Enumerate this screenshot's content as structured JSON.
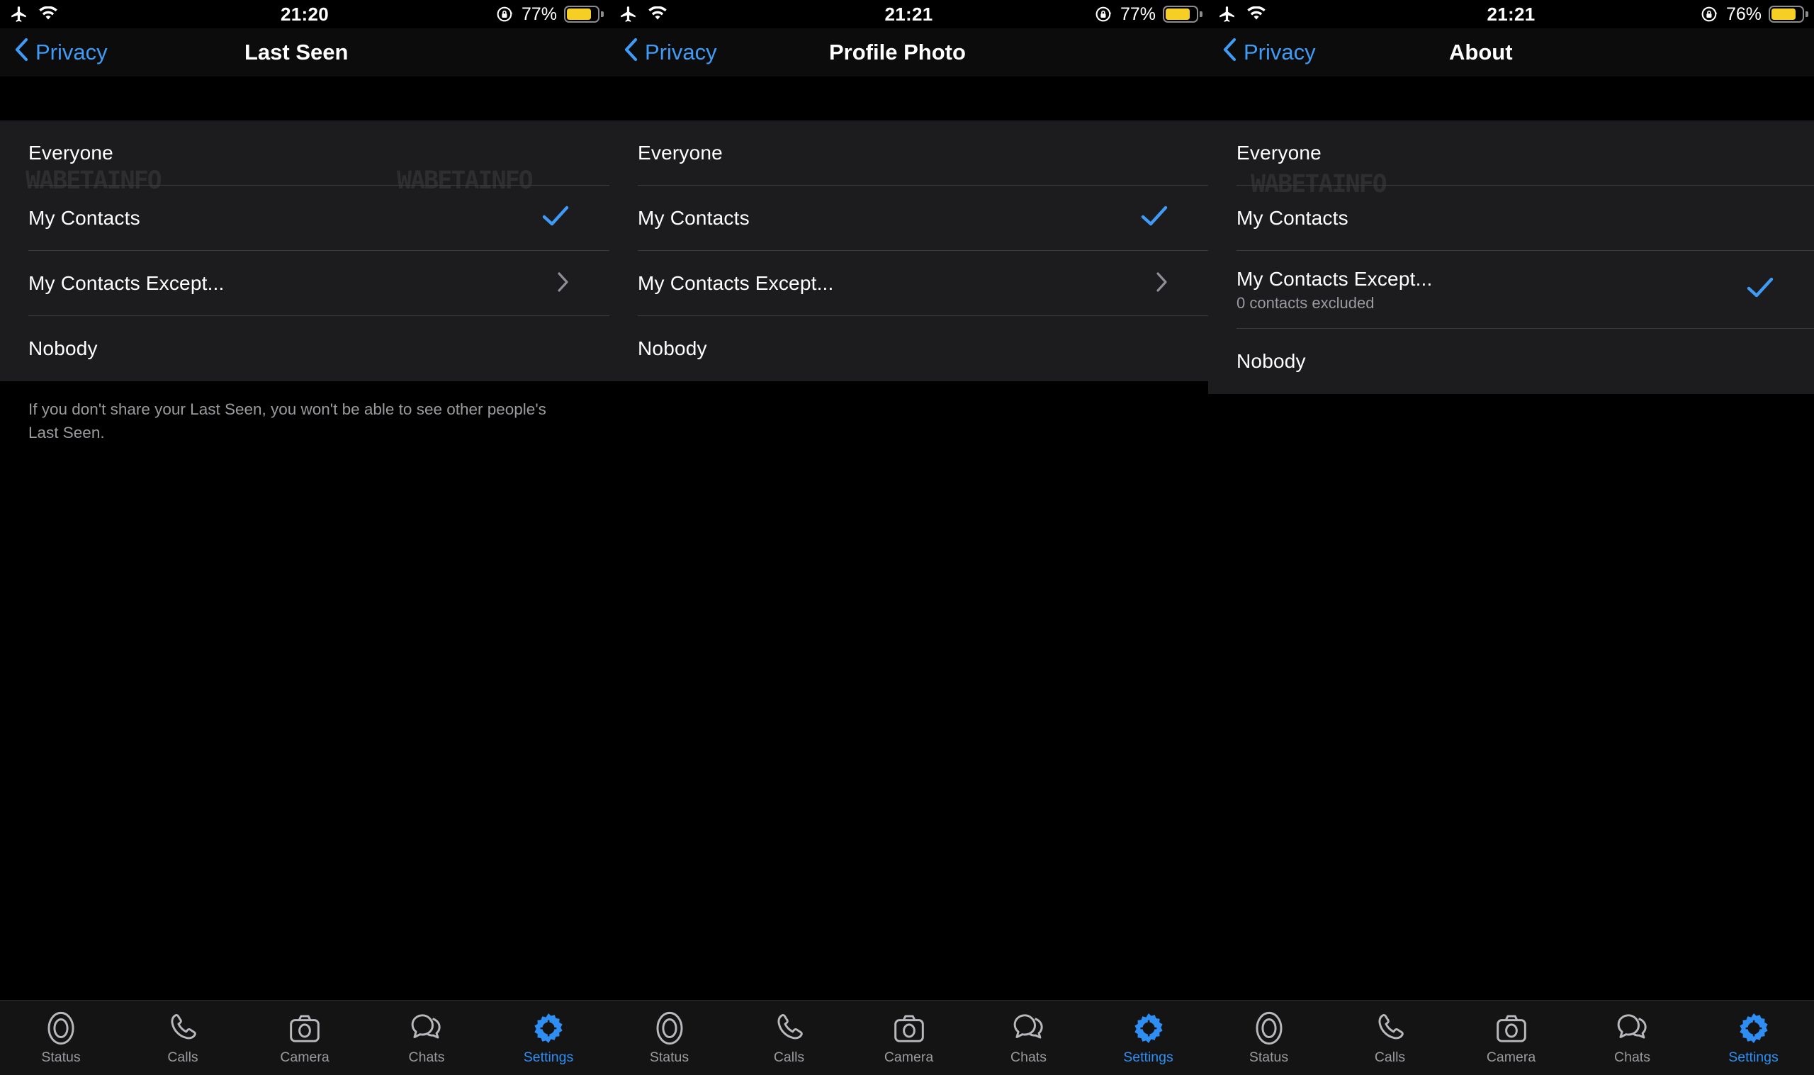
{
  "theme": {
    "background": "#000000",
    "list_background": "#1c1c1e",
    "navbar_background": "#0c0c0c",
    "accent_blue": "#3f9bf5",
    "separator": "#3a3a3c",
    "secondary_text": "#9b9b9f",
    "battery_yellow": "#f5cf24"
  },
  "watermark": {
    "text": "WABETAINFO"
  },
  "panels": [
    {
      "id": "last-seen",
      "status": {
        "time": "21:20",
        "battery_percent": "77%",
        "icons": {
          "airplane": "airplane-mode-icon",
          "wifi": "wifi-icon",
          "rotation_lock": "rotation-lock-icon",
          "battery": "battery-icon"
        }
      },
      "nav": {
        "back_label": "Privacy",
        "title": "Last Seen",
        "back_icon": "chevron-left-icon"
      },
      "rows": [
        {
          "title": "Everyone",
          "subtitle": "",
          "accessory": "none"
        },
        {
          "title": "My Contacts",
          "subtitle": "",
          "accessory": "check"
        },
        {
          "title": "My Contacts Except...",
          "subtitle": "",
          "accessory": "chevron"
        },
        {
          "title": "Nobody",
          "subtitle": "",
          "accessory": "none"
        }
      ],
      "footer": "If you don't share your Last Seen, you won't be able to see other people's Last Seen."
    },
    {
      "id": "profile-photo",
      "status": {
        "time": "21:21",
        "battery_percent": "77%",
        "icons": {
          "airplane": "airplane-mode-icon",
          "wifi": "wifi-icon",
          "rotation_lock": "rotation-lock-icon",
          "battery": "battery-icon"
        }
      },
      "nav": {
        "back_label": "Privacy",
        "title": "Profile Photo",
        "back_icon": "chevron-left-icon"
      },
      "rows": [
        {
          "title": "Everyone",
          "subtitle": "",
          "accessory": "none"
        },
        {
          "title": "My Contacts",
          "subtitle": "",
          "accessory": "check"
        },
        {
          "title": "My Contacts Except...",
          "subtitle": "",
          "accessory": "chevron"
        },
        {
          "title": "Nobody",
          "subtitle": "",
          "accessory": "none"
        }
      ],
      "footer": ""
    },
    {
      "id": "about",
      "status": {
        "time": "21:21",
        "battery_percent": "76%",
        "icons": {
          "airplane": "airplane-mode-icon",
          "wifi": "wifi-icon",
          "rotation_lock": "rotation-lock-icon",
          "battery": "battery-icon"
        }
      },
      "nav": {
        "back_label": "Privacy",
        "title": "About",
        "back_icon": "chevron-left-icon"
      },
      "rows": [
        {
          "title": "Everyone",
          "subtitle": "",
          "accessory": "none"
        },
        {
          "title": "My Contacts",
          "subtitle": "",
          "accessory": "none"
        },
        {
          "title": "My Contacts Except...",
          "subtitle": "0 contacts excluded",
          "accessory": "check"
        },
        {
          "title": "Nobody",
          "subtitle": "",
          "accessory": "none"
        }
      ],
      "footer": ""
    }
  ],
  "tabbar": {
    "items": [
      {
        "label": "Status",
        "icon": "status-ring-icon",
        "active": false
      },
      {
        "label": "Calls",
        "icon": "phone-icon",
        "active": false
      },
      {
        "label": "Camera",
        "icon": "camera-icon",
        "active": false
      },
      {
        "label": "Chats",
        "icon": "chat-bubbles-icon",
        "active": false
      },
      {
        "label": "Settings",
        "icon": "gear-icon",
        "active": true
      }
    ]
  }
}
